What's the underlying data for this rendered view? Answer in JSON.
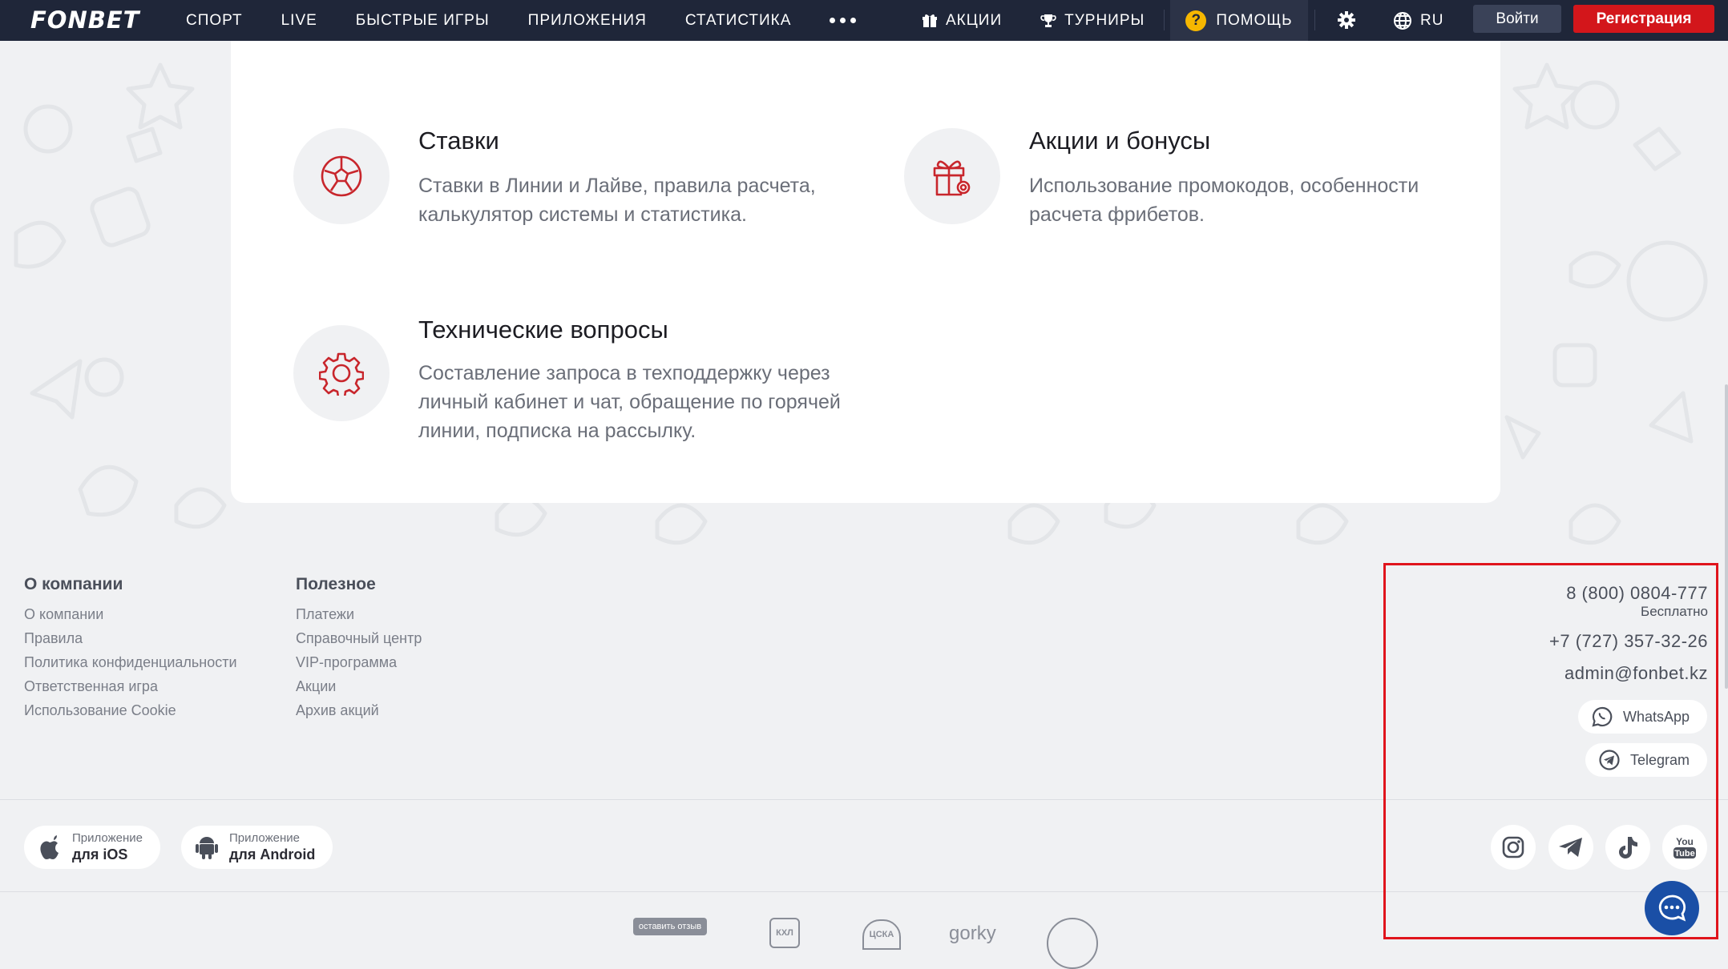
{
  "header": {
    "logo": "FONBET",
    "nav": [
      "СПОРТ",
      "LIVE",
      "БЫСТРЫЕ ИГРЫ",
      "ПРИЛОЖЕНИЯ",
      "СТАТИСТИКА"
    ],
    "promotions": "АКЦИИ",
    "tournaments": "ТУРНИРЫ",
    "help": "ПОМОЩЬ",
    "help_mark": "?",
    "language": "RU",
    "login": "Войти",
    "register": "Регистрация"
  },
  "topics": [
    {
      "title": "Ставки",
      "desc": "Ставки в Линии и Лайве, правила расчета, калькулятор системы и статистика.",
      "icon": "soccer-ball-icon"
    },
    {
      "title": "Акции и бонусы",
      "desc": "Использование промокодов, особенности расчета фрибетов.",
      "icon": "gift-icon"
    },
    {
      "title": "Технические вопросы",
      "desc": "Составление запроса в техподдержку через личный кабинет и чат, обращение по горячей линии, подписка на рассылку.",
      "icon": "gear-icon"
    }
  ],
  "footer": {
    "company": {
      "heading": "О компании",
      "links": [
        "О компании",
        "Правила",
        "Политика конфиденциальности",
        "Ответственная игра",
        "Использование Cookie"
      ]
    },
    "useful": {
      "heading": "Полезное",
      "links": [
        "Платежи",
        "Справочный центр",
        "VIP-программа",
        "Акции",
        "Архив акций"
      ]
    },
    "contacts": {
      "phone_free": "8 (800) 0804-777",
      "free_label": "Бесплатно",
      "phone": "+7 (727) 357-32-26",
      "email": "admin@fonbet.kz",
      "whatsapp": "WhatsApp",
      "telegram": "Telegram"
    },
    "apps": {
      "ios_small": "Приложение",
      "ios_big": "для iOS",
      "android_small": "Приложение",
      "android_big": "для Android"
    },
    "social": [
      "instagram-icon",
      "telegram-icon",
      "tiktok-icon",
      "youtube-icon"
    ],
    "partners": {
      "review_badge": "оставить отзыв",
      "khl": "КХЛ",
      "cska": "ЦСКА",
      "gorky": "gorky"
    }
  },
  "colors": {
    "header_bg": "#1f2639",
    "accent_red": "#d3161b",
    "help_yellow": "#f6b700",
    "chat_blue": "#1a4fa6"
  }
}
